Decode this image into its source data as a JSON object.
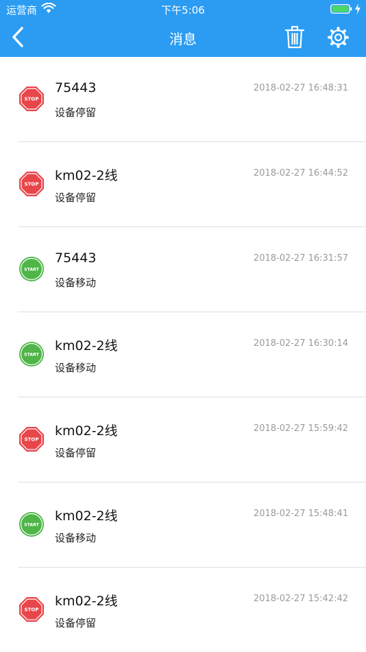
{
  "status_bar": {
    "carrier": "运营商",
    "time": "下午5:06"
  },
  "nav": {
    "title": "消息",
    "back_icon": "chevron-left-icon",
    "trash_icon": "trash-icon",
    "settings_icon": "gear-icon"
  },
  "colors": {
    "header_bg": "#2b9cf2",
    "stop_red": "#e8464a",
    "start_green": "#4fb548",
    "time_gray": "#9a9a9a"
  },
  "messages": [
    {
      "status": "stop",
      "badge": "STOP",
      "device": "75443",
      "time": "2018-02-27 16:48:31",
      "event": "设备停留"
    },
    {
      "status": "stop",
      "badge": "STOP",
      "device": "km02-2线",
      "time": "2018-02-27 16:44:52",
      "event": "设备停留"
    },
    {
      "status": "start",
      "badge": "START",
      "device": "75443",
      "time": "2018-02-27 16:31:57",
      "event": "设备移动"
    },
    {
      "status": "start",
      "badge": "START",
      "device": "km02-2线",
      "time": "2018-02-27 16:30:14",
      "event": "设备移动"
    },
    {
      "status": "stop",
      "badge": "STOP",
      "device": "km02-2线",
      "time": "2018-02-27 15:59:42",
      "event": "设备停留"
    },
    {
      "status": "start",
      "badge": "START",
      "device": "km02-2线",
      "time": "2018-02-27 15:48:41",
      "event": "设备移动"
    },
    {
      "status": "stop",
      "badge": "STOP",
      "device": "km02-2线",
      "time": "2018-02-27 15:42:42",
      "event": "设备停留"
    }
  ]
}
